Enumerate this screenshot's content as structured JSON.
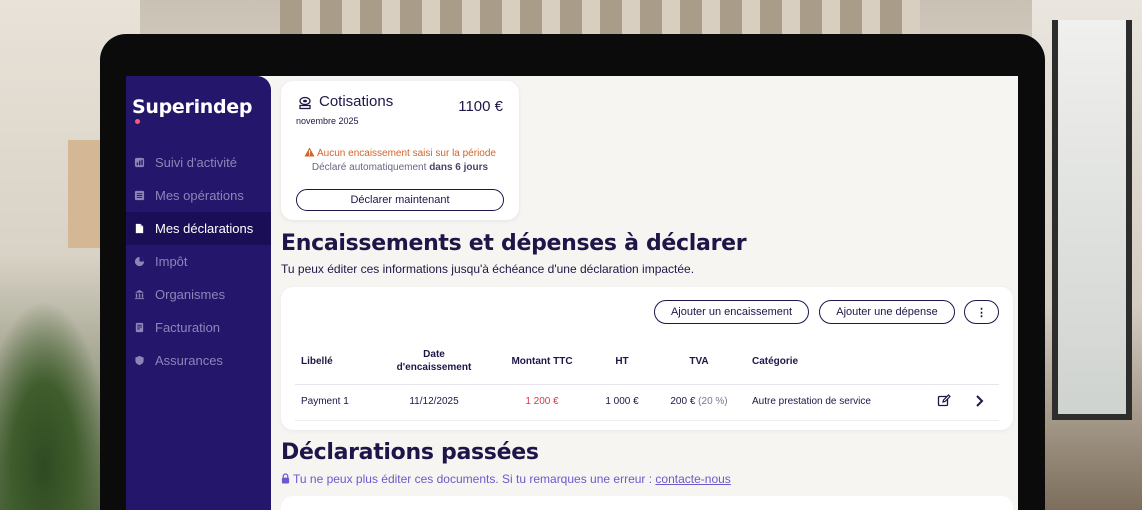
{
  "app": {
    "logo": "Superindep"
  },
  "sidebar": {
    "items": [
      {
        "label": "Suivi d'activité",
        "icon": "chart-pie-icon",
        "active": false
      },
      {
        "label": "Mes opérations",
        "icon": "list-icon",
        "active": false
      },
      {
        "label": "Mes déclarations",
        "icon": "document-icon",
        "active": true
      },
      {
        "label": "Impôt",
        "icon": "pie-icon",
        "active": false
      },
      {
        "label": "Organismes",
        "icon": "bank-icon",
        "active": false
      },
      {
        "label": "Facturation",
        "icon": "invoice-icon",
        "active": false
      },
      {
        "label": "Assurances",
        "icon": "shield-icon",
        "active": false
      }
    ]
  },
  "cotisations": {
    "title": "Cotisations",
    "amount": "1100 €",
    "period": "novembre 2025",
    "warning": "Aucun encaissement saisi sur la période",
    "auto_prefix": "Déclaré automatiquement",
    "auto_delay": "dans 6 jours",
    "button": "Déclarer maintenant"
  },
  "encaissements": {
    "title": "Encaissements et dépenses à déclarer",
    "subtitle": "Tu peux éditer ces informations jusqu'à échéance d'une déclaration impactée.",
    "add_income": "Ajouter un encaissement",
    "add_expense": "Ajouter une dépense",
    "more": "⋮",
    "columns": {
      "libelle": "Libellé",
      "date_1": "Date",
      "date_2": "d'encaissement",
      "ttc": "Montant TTC",
      "ht": "HT",
      "tva": "TVA",
      "categorie": "Catégorie"
    },
    "rows": [
      {
        "libelle": "Payment 1",
        "date": "11/12/2025",
        "ttc": "1 200 €",
        "ht": "1 000 €",
        "tva": "200 €",
        "tva_rate": "(20 %)",
        "categorie": "Autre prestation de service"
      }
    ]
  },
  "passees": {
    "title": "Déclarations passées",
    "notice": "Tu ne peux plus éditer ces documents. Si tu remarques une erreur :",
    "link": "contacte-nous"
  },
  "colors": {
    "sidebar": "#23166b",
    "sidebar_active": "#1a0f57",
    "text": "#1e1648",
    "warning": "#d0642b",
    "amount_red": "#d23a4a",
    "link": "#6a5acd"
  }
}
